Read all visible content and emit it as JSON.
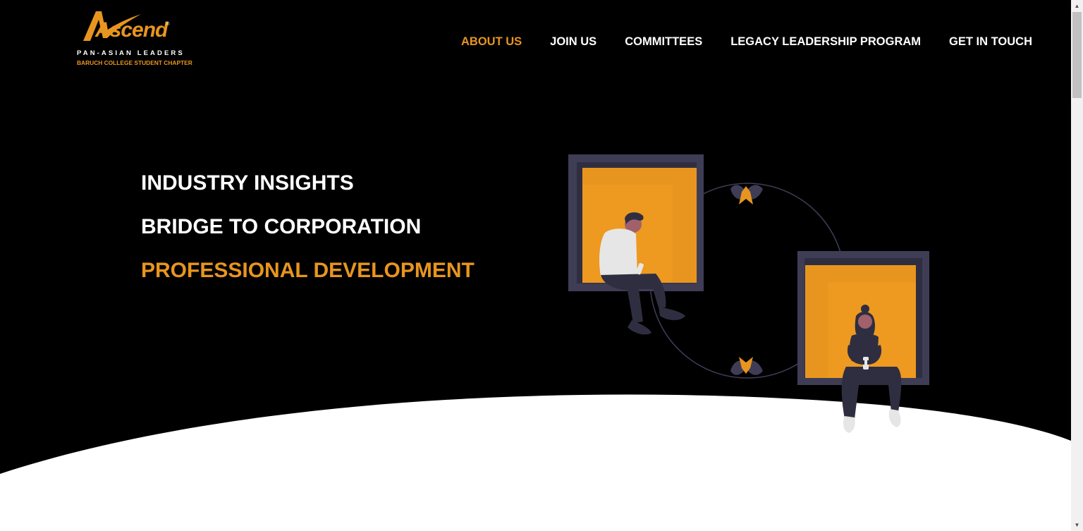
{
  "logo": {
    "word": "Ascend",
    "tagline": "PAN-ASIAN LEADERS",
    "subline": "BARUCH COLLEGE STUDENT CHAPTER",
    "reg_mark": "®"
  },
  "nav": {
    "items": [
      {
        "label": "ABOUT US",
        "active": true
      },
      {
        "label": "JOIN US",
        "active": false
      },
      {
        "label": "COMMITTEES",
        "active": false
      },
      {
        "label": "LEGACY LEADERSHIP PROGRAM",
        "active": false
      },
      {
        "label": "GET IN TOUCH",
        "active": false
      }
    ]
  },
  "hero": {
    "lines": [
      "INDUSTRY INSIGHTS",
      "BRIDGE TO CORPORATION",
      "PROFESSIONAL DEVELOPMENT"
    ]
  },
  "colors": {
    "accent": "#e8951f",
    "background": "#000000",
    "text": "#ffffff",
    "frame": "#3f3d56"
  },
  "scrollbar": {
    "up_icon": "triangle-up",
    "down_icon": "triangle-down"
  }
}
